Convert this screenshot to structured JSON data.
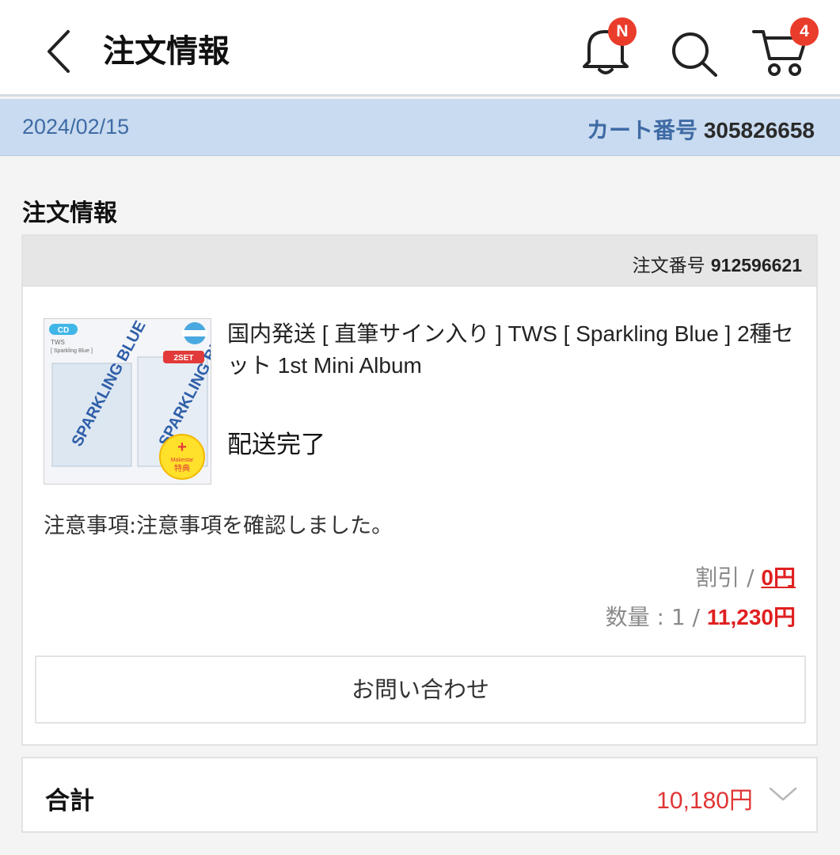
{
  "header": {
    "title": "注文情報",
    "notification_badge": "N",
    "cart_badge": "4",
    "icons": [
      "chevron-left-icon",
      "bell-icon",
      "search-icon",
      "cart-icon"
    ]
  },
  "cart_bar": {
    "date": "2024/02/15",
    "cart_number_label": "カート番号",
    "cart_number": "305826658"
  },
  "section": {
    "title": "注文情報"
  },
  "order": {
    "order_number_label": "注文番号",
    "order_number": "912596621",
    "product_name": "国内発送 [ 直筆サイン入り ] TWS [ Sparkling Blue ] 2種セット 1st Mini Album",
    "shipping_status": "配送完了",
    "notes": "注意事項:注意事項を確認しました。",
    "discount_label": "割引 / ",
    "discount_value": "0円",
    "quantity_label": "数量 : 1 / ",
    "price_value": "11,230円",
    "inquiry_button": "お問い合わせ",
    "thumbnail": {
      "cd_tag": "CD",
      "artist": "TWS",
      "album": "[ Sparkling Blue ]",
      "set_tag": "2SET",
      "cover_text": "SPARKLING BLUE",
      "bonus_plus": "+",
      "bonus_label": "Makestar",
      "bonus_text": "特典"
    }
  },
  "total": {
    "label": "合計",
    "value": "10,180円"
  },
  "colors": {
    "accent_blue": "#3f6ba5",
    "cart_bar_bg": "#c9dbf0",
    "price_red": "#e02020",
    "badge_red": "#ea3c2b"
  }
}
